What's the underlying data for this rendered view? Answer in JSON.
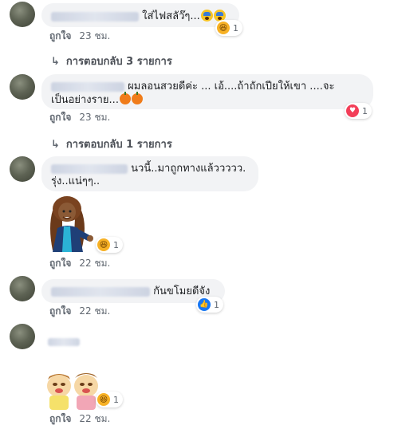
{
  "comments": [
    {
      "text": "ใส่ไฟสลัว๊ๆ...",
      "like": "ถูกใจ",
      "time": "23 ชม.",
      "reaction_count": "1",
      "reaction": "haha"
    },
    {
      "text_line1": "ผมลอนสวยดีค่ะ ... เอ้....ถ้าถักเปียให้เขา ....จะ",
      "text_line2": "เป็นอย่างราย...",
      "like": "ถูกใจ",
      "time": "23 ชม.",
      "reaction_count": "1",
      "reaction": "love"
    },
    {
      "text_line1": "นวนี้..มาถูกทางแล้ววววว.",
      "text_line2": "รุ่ง..แน่ๆๆ..",
      "like": "ถูกใจ",
      "time": "22 ชม.",
      "reaction_count": "1",
      "reaction": "haha"
    },
    {
      "text": "กันขโมยดีจัง",
      "like": "ถูกใจ",
      "time": "22 ชม.",
      "reaction_count": "1",
      "reaction": "like"
    },
    {
      "like": "ถูกใจ",
      "time": "22 ชม.",
      "reaction_count": "1",
      "reaction": "haha"
    }
  ],
  "replies": [
    {
      "label": "การตอบกลับ 3 รายการ"
    },
    {
      "label": "การตอบกลับ 1 รายการ"
    }
  ],
  "icons": {
    "reply_arrow": "↳",
    "haha": "😆",
    "love": "♥",
    "like": "👍"
  },
  "colors": {
    "bubble": "#f2f3f5",
    "meta_text": "#606770",
    "like_blue": "#1877f2",
    "love_red": "#f33e58",
    "haha_yellow": "#f7b125"
  }
}
